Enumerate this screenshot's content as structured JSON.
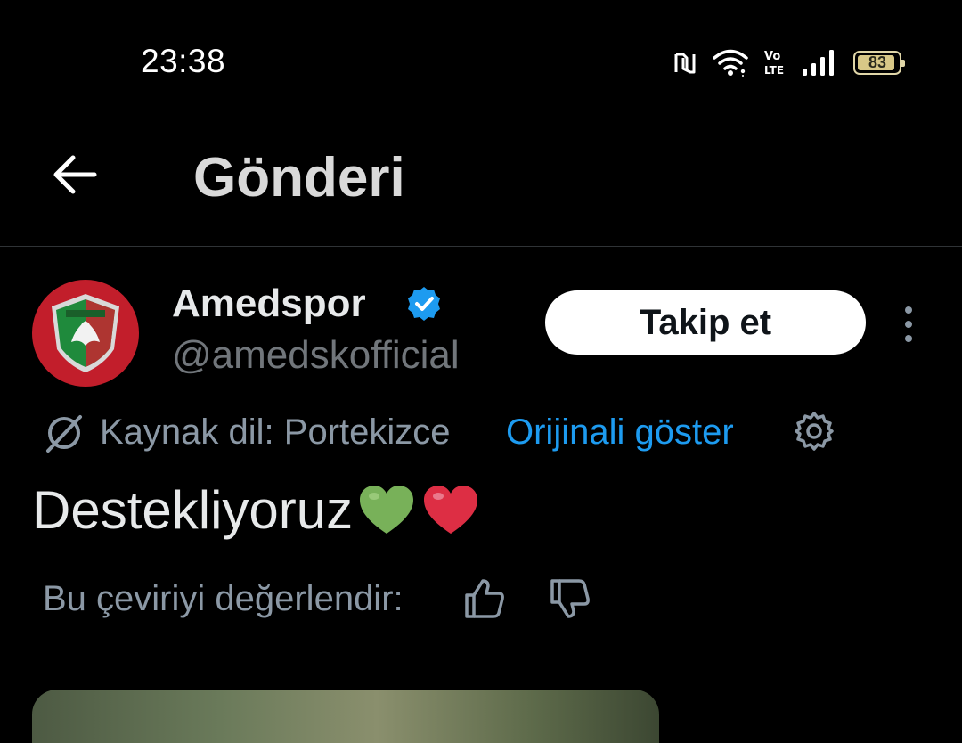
{
  "status_bar": {
    "time": "23:38",
    "battery": "83",
    "icons": [
      "nfc-icon",
      "wifi-icon",
      "volte-icon",
      "signal-icon",
      "battery-icon"
    ]
  },
  "header": {
    "title": "Gönderi",
    "back_icon": "arrow-left-icon"
  },
  "author": {
    "name": "Amedspor",
    "handle": "@amedskofficial",
    "verified": true,
    "follow_label": "Takip et"
  },
  "translation": {
    "source_language": "Kaynak dil: Portekizce",
    "show_original": "Orijinali göster"
  },
  "tweet": {
    "text": "Destekliyoruz",
    "emojis": [
      "green-heart",
      "red-heart"
    ]
  },
  "rating": {
    "label": "Bu çeviriyi değerlendir:"
  },
  "colors": {
    "background": "#000000",
    "accent": "#1d9bf0",
    "secondary_text": "#71767b"
  }
}
